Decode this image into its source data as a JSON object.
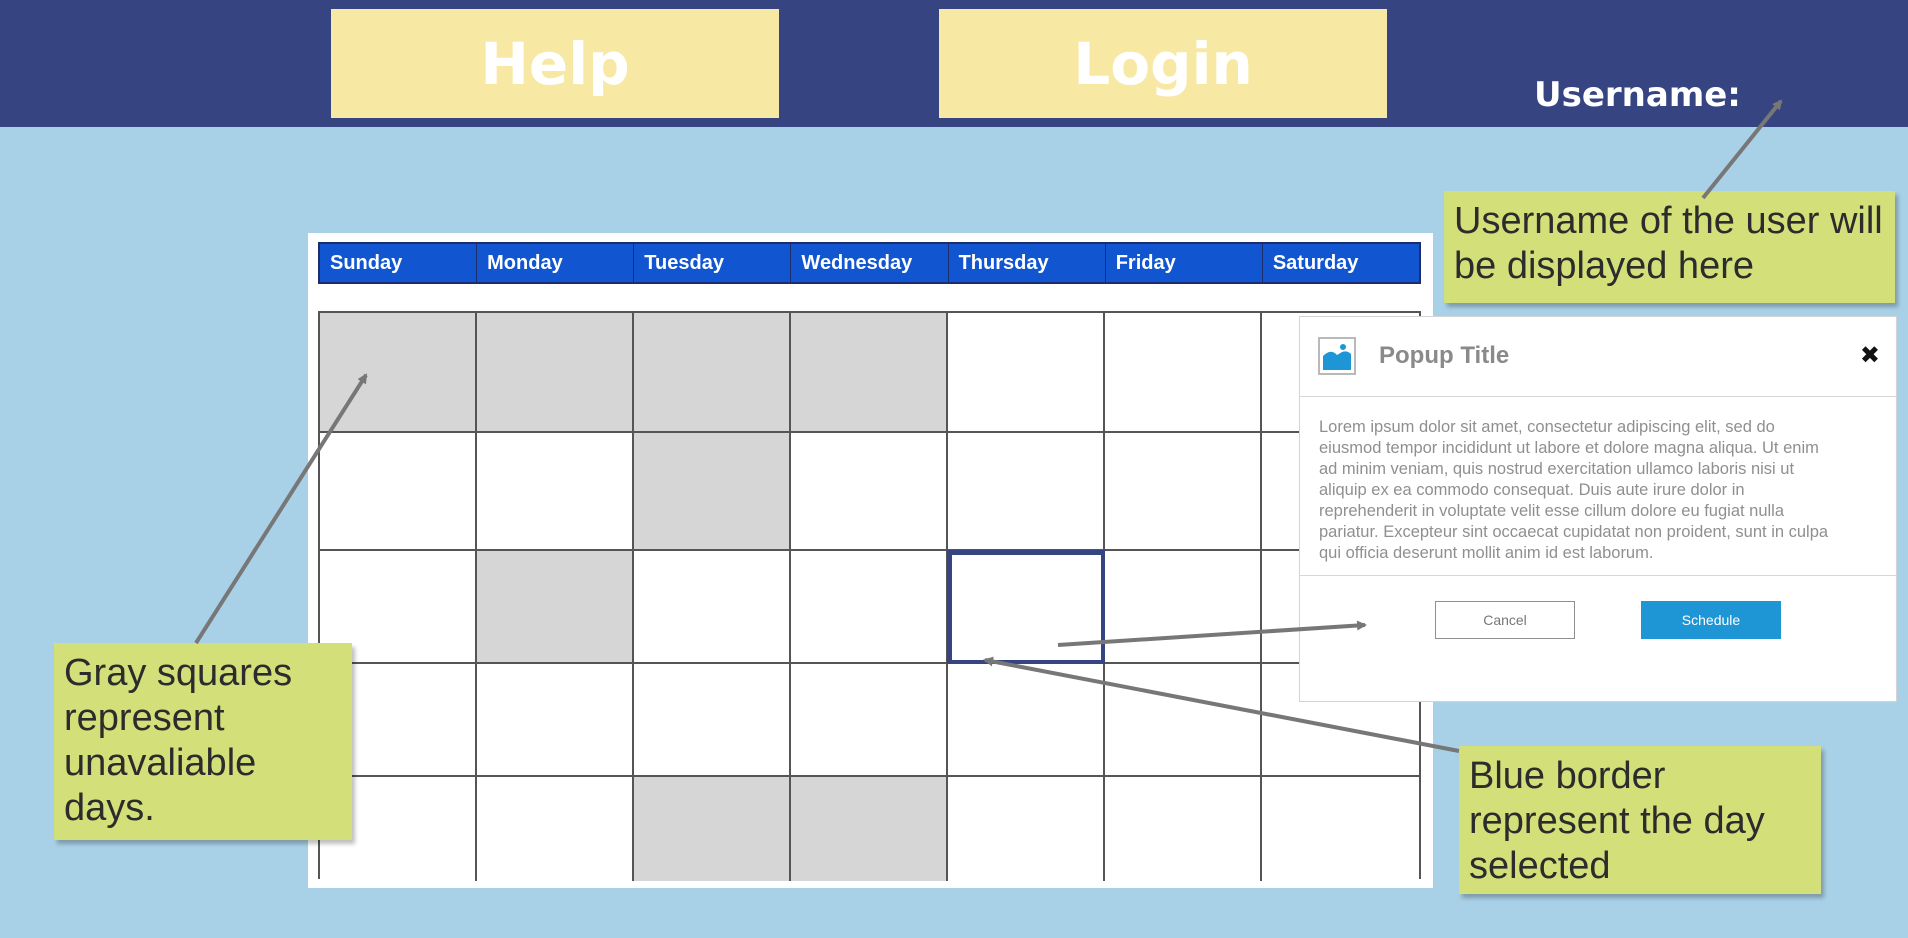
{
  "header": {
    "help_label": "Help",
    "login_label": "Login",
    "username_label": "Username:"
  },
  "calendar": {
    "days": [
      "Sunday",
      "Monday",
      "Tuesday",
      "Wednesday",
      "Thursday",
      "Friday",
      "Saturday"
    ],
    "weeks": 5,
    "unavailable_cells": [
      [
        1,
        1
      ],
      [
        1,
        2
      ],
      [
        1,
        3
      ],
      [
        1,
        4
      ],
      [
        2,
        3
      ],
      [
        3,
        2
      ],
      [
        5,
        3
      ],
      [
        5,
        4
      ]
    ],
    "selected_cell": [
      3,
      5
    ]
  },
  "popup": {
    "title": "Popup Title",
    "close_glyph": "✖",
    "body": "Lorem ipsum dolor sit amet, consectetur adipiscing elit, sed do eiusmod tempor incididunt ut labore et dolore magna aliqua. Ut enim ad minim veniam, quis nostrud exercitation ullamco laboris nisi ut aliquip ex ea commodo consequat. Duis aute irure dolor in reprehenderit in voluptate velit esse cillum dolore eu fugiat nulla pariatur. Excepteur sint occaecat cupidatat non proident, sunt in culpa qui officia deserunt mollit anim id est laborum.",
    "cancel_label": "Cancel",
    "schedule_label": "Schedule",
    "image_icon": "image-icon"
  },
  "notes": {
    "username_note": "Username of the user will be displayed here",
    "gray_note": "Gray squares represent unavaliable days.",
    "selected_note": "Blue border represent the day selected"
  },
  "colors": {
    "header_bg": "#364582",
    "nav_button_bg": "#f7e9a3",
    "page_bg": "#a8d0e6",
    "day_header_bg": "#1156d0",
    "unavailable": "#d6d6d6",
    "selected_border": "#364582",
    "note_bg": "#d3e07a",
    "schedule_button": "#1e96d6"
  }
}
